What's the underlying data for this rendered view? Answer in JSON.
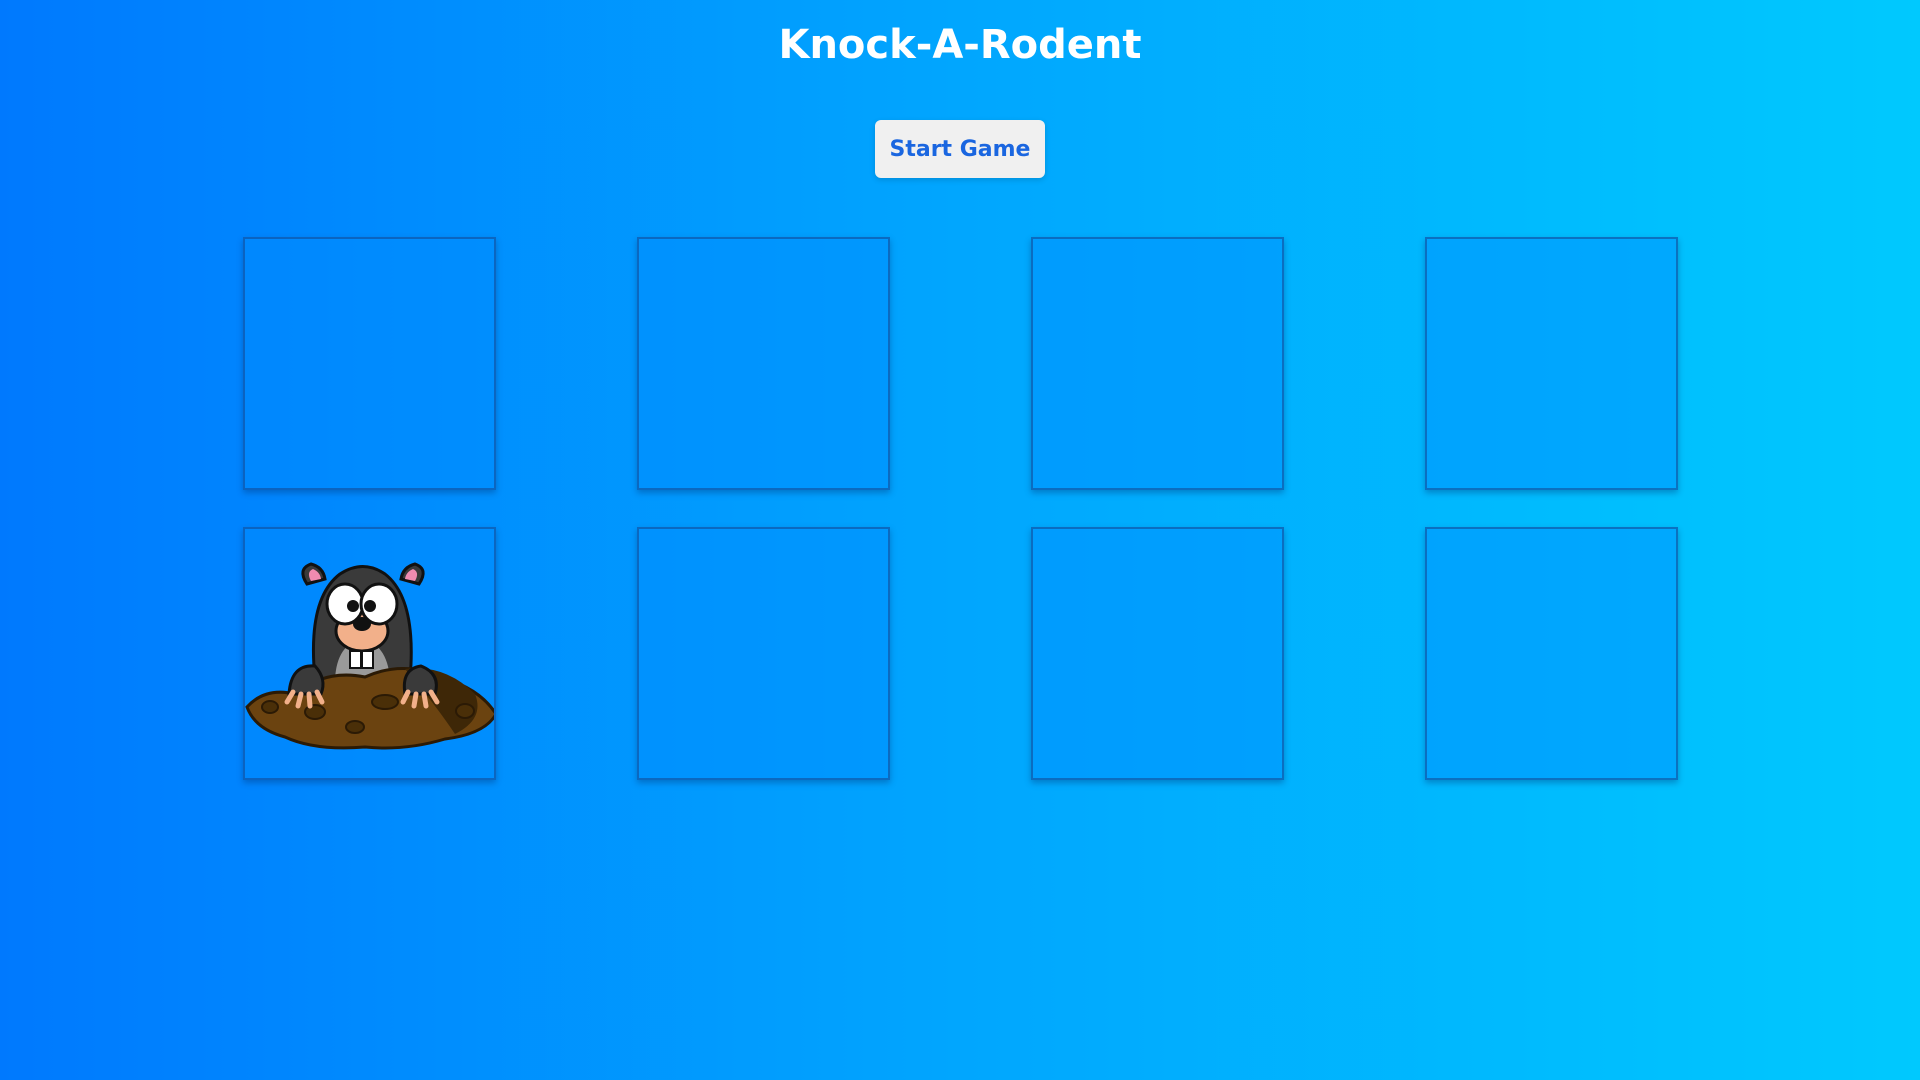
{
  "game": {
    "title": "Knock-A-Rodent",
    "start_button_label": "Start Game"
  },
  "board": {
    "rows": 2,
    "columns": 4,
    "holes": [
      {
        "mole_visible": false
      },
      {
        "mole_visible": false
      },
      {
        "mole_visible": false
      },
      {
        "mole_visible": false
      },
      {
        "mole_visible": true
      },
      {
        "mole_visible": false
      },
      {
        "mole_visible": false
      },
      {
        "mole_visible": false
      }
    ]
  },
  "colors": {
    "background_left": "#0079fe",
    "background_right": "#00c9fe",
    "button_text": "#1a66e0",
    "button_bg": "#f0f0f0"
  }
}
